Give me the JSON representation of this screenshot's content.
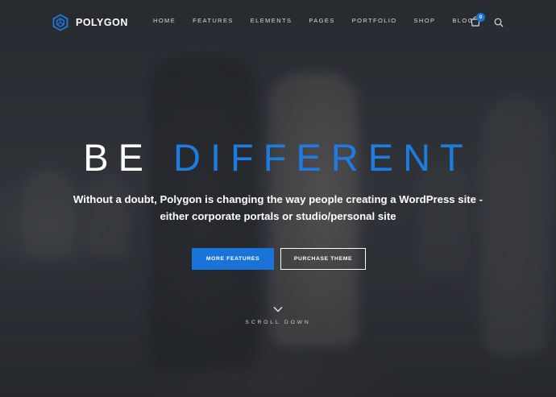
{
  "brand": {
    "name": "POLYGON",
    "icon": "polygon-logo-icon",
    "accent": "#1a73d9"
  },
  "nav": {
    "items": [
      {
        "label": "HOME"
      },
      {
        "label": "FEATURES"
      },
      {
        "label": "ELEMENTS"
      },
      {
        "label": "PAGES"
      },
      {
        "label": "PORTFOLIO"
      },
      {
        "label": "SHOP"
      },
      {
        "label": "BLOG"
      }
    ],
    "cart_count": "0",
    "cart_icon": "cart-icon",
    "search_icon": "search-icon"
  },
  "hero": {
    "headline_word1": "BE",
    "headline_word2": "DIFFERENT",
    "subtitle_line1": "Without a doubt, Polygon is changing the way people creating a WordPress site -",
    "subtitle_line2": "either corporate portals or studio/personal site",
    "primary_button": "MORE FEATURES",
    "secondary_button": "PURCHASE THEME",
    "scroll_label": "SCROLL DOWN",
    "scroll_icon": "chevron-down-icon"
  },
  "colors": {
    "headline_white": "#ffffff",
    "headline_blue": "#1e7be0",
    "button_blue": "#1a73d9"
  }
}
